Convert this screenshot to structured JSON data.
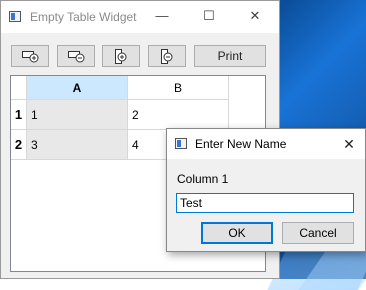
{
  "window": {
    "title": "Empty Table Widget",
    "controls": {
      "minimize": "—",
      "maximize": "☐",
      "close": "✕"
    }
  },
  "toolbar": {
    "buttons": [
      {
        "icon": "add-row-icon"
      },
      {
        "icon": "remove-row-icon"
      },
      {
        "icon": "add-column-icon"
      },
      {
        "icon": "remove-column-icon"
      }
    ],
    "print_label": "Print"
  },
  "table": {
    "columns": [
      "A",
      "B"
    ],
    "rows": [
      {
        "header": "1",
        "cells": [
          "1",
          "2"
        ]
      },
      {
        "header": "2",
        "cells": [
          "3",
          "4"
        ]
      }
    ]
  },
  "dialog": {
    "title": "Enter New Name",
    "close": "✕",
    "label": "Column 1",
    "input_value": "Test",
    "ok_label": "OK",
    "cancel_label": "Cancel"
  },
  "colors": {
    "selected_header": "#cce8ff",
    "focus_accent": "#0078d7"
  }
}
